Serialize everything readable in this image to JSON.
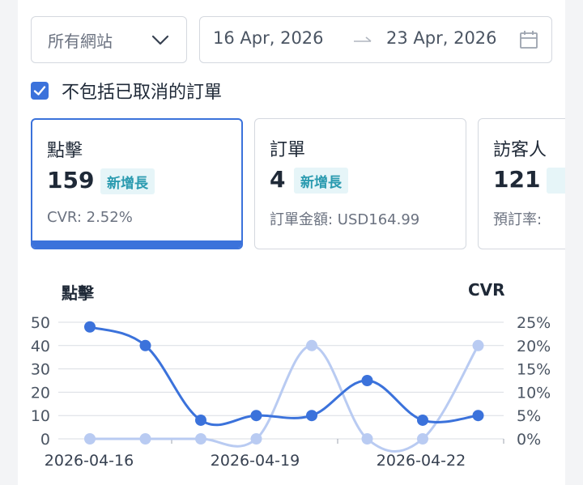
{
  "filters": {
    "site_select": {
      "value": "所有網站",
      "icon": "chevron-down-icon"
    },
    "date_range": {
      "start": "16 Apr, 2026",
      "end": "23 Apr, 2026",
      "icon": "calendar-icon"
    }
  },
  "checkbox": {
    "label": "不包括已取消的訂單",
    "checked": true,
    "color": "#3b72db"
  },
  "cards": [
    {
      "title": "點擊",
      "value": "159",
      "badge": "新增長",
      "sub": "CVR: 2.52%",
      "active": true
    },
    {
      "title": "訂單",
      "value": "4",
      "badge": "新增長",
      "sub": "訂單金額: USD164.99",
      "active": false
    },
    {
      "title": "訪客人",
      "value": "121",
      "badge": "",
      "sub": "預訂率:",
      "active": false
    }
  ],
  "colors": {
    "accent": "#3b72db",
    "series_light": "#b9cbf2",
    "badge_bg": "#e6f5f8",
    "badge_text": "#2b9bb0"
  },
  "chart_data": {
    "type": "line",
    "title_left": "點擊",
    "title_right": "CVR",
    "x": [
      "2026-04-16",
      "2026-04-17",
      "2026-04-18",
      "2026-04-19",
      "2026-04-20",
      "2026-04-21",
      "2026-04-22",
      "2026-04-23"
    ],
    "x_tick_labels": [
      "2026-04-16",
      "2026-04-19",
      "2026-04-22"
    ],
    "y_left": {
      "ticks": [
        0,
        10,
        20,
        30,
        40,
        50
      ],
      "ylim": [
        0,
        50
      ]
    },
    "y_right": {
      "ticks": [
        "0%",
        "5%",
        "10%",
        "15%",
        "20%",
        "25%"
      ],
      "ylim": [
        0,
        25
      ]
    },
    "grid": true,
    "series": [
      {
        "axis": "left",
        "values": [
          48,
          40,
          8,
          10,
          10,
          25,
          8,
          10
        ]
      },
      {
        "axis": "right",
        "values": [
          0,
          0,
          0,
          0,
          20,
          0,
          0,
          20
        ]
      }
    ]
  }
}
